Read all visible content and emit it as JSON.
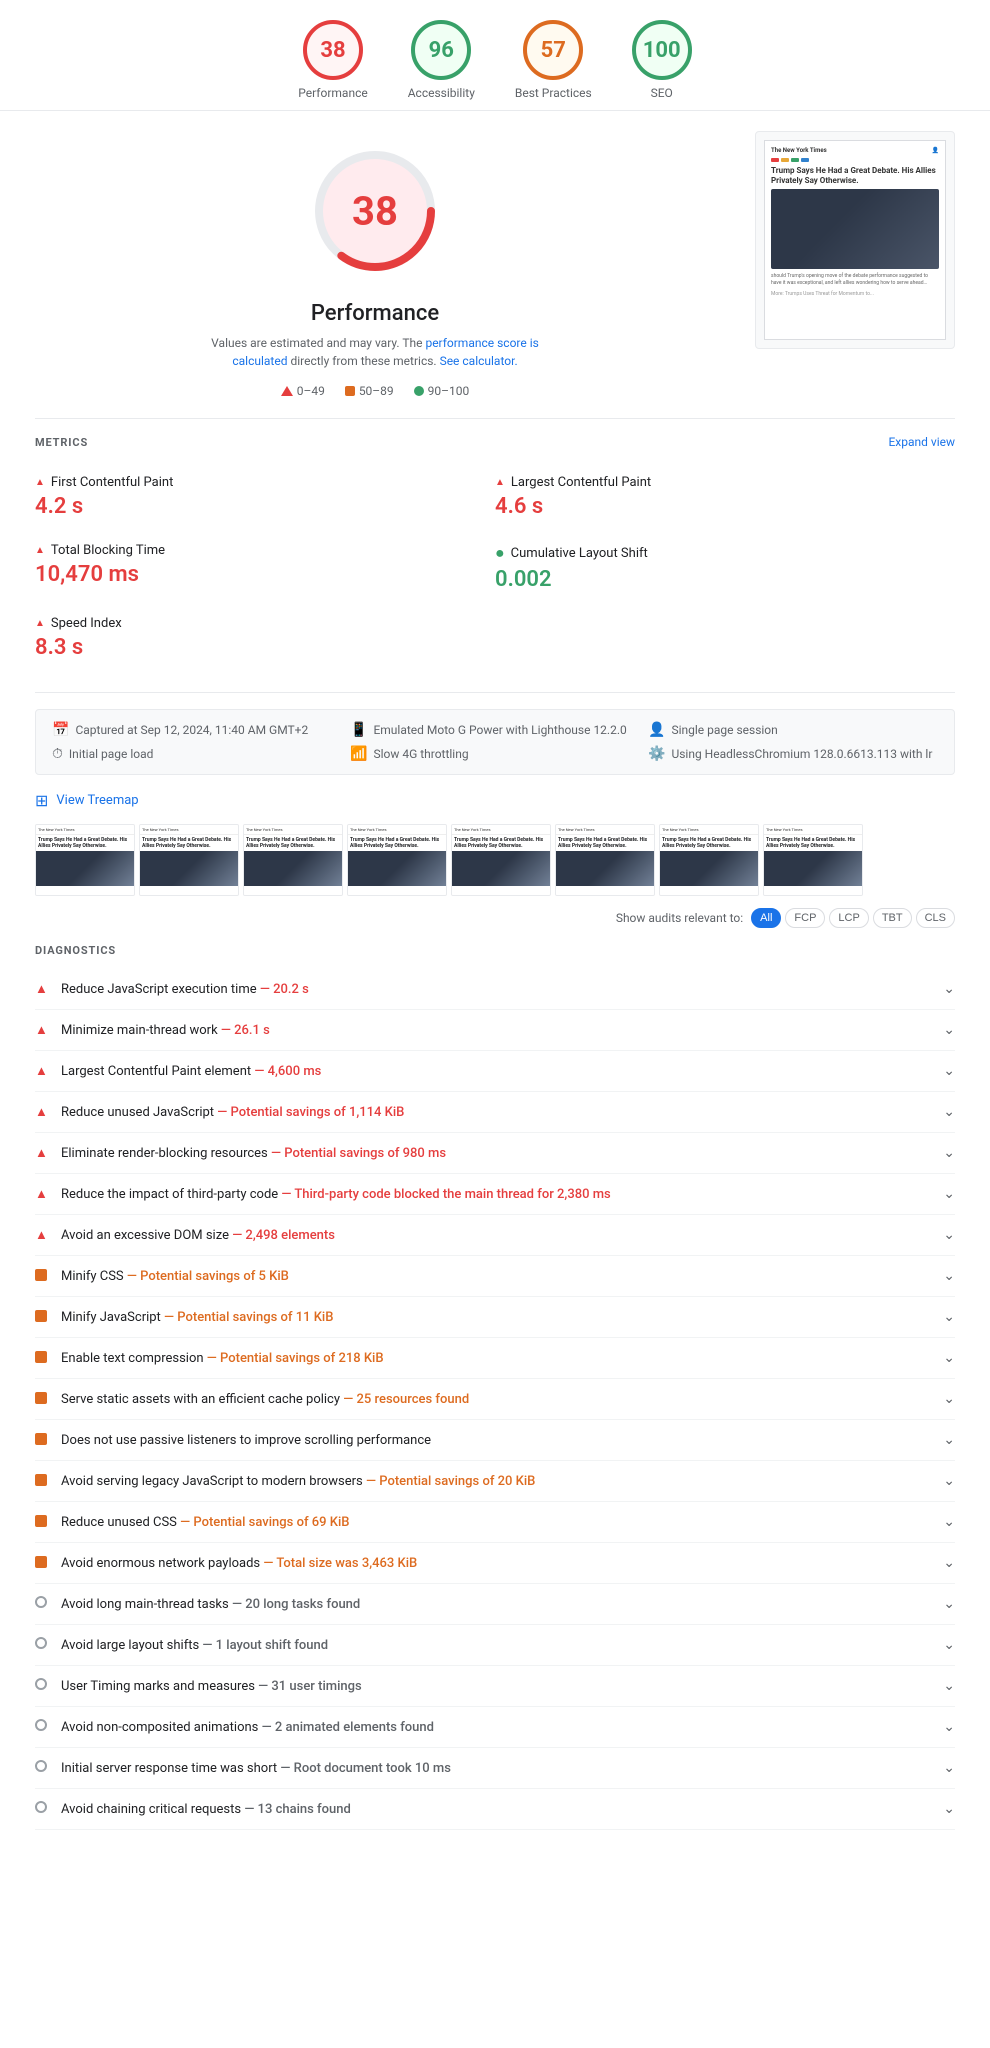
{
  "scores": [
    {
      "id": "performance",
      "value": 38,
      "label": "Performance",
      "type": "red"
    },
    {
      "id": "accessibility",
      "value": 96,
      "label": "Accessibility",
      "type": "green"
    },
    {
      "id": "best-practices",
      "value": 57,
      "label": "Best Practices",
      "type": "orange"
    },
    {
      "id": "seo",
      "value": 100,
      "label": "SEO",
      "type": "green"
    }
  ],
  "performance": {
    "score": 38,
    "title": "Performance",
    "desc_text": "Values are estimated and may vary. The ",
    "desc_link1": "performance score is calculated",
    "desc_mid": " directly from these metrics. ",
    "desc_link2": "See calculator.",
    "legend": [
      {
        "type": "tri",
        "range": "0–49"
      },
      {
        "type": "sq",
        "range": "50–89"
      },
      {
        "type": "dot",
        "range": "90–100"
      }
    ]
  },
  "metrics": {
    "title": "METRICS",
    "expand_label": "Expand view",
    "items": [
      {
        "id": "fcp",
        "name": "First Contentful Paint",
        "value": "4.2 s",
        "color": "red",
        "icon": "tri"
      },
      {
        "id": "lcp",
        "name": "Largest Contentful Paint",
        "value": "4.6 s",
        "color": "red",
        "icon": "tri"
      },
      {
        "id": "tbt",
        "name": "Total Blocking Time",
        "value": "10,470 ms",
        "color": "red",
        "icon": "tri"
      },
      {
        "id": "cls",
        "name": "Cumulative Layout Shift",
        "value": "0.002",
        "color": "green",
        "icon": "dot"
      },
      {
        "id": "si",
        "name": "Speed Index",
        "value": "8.3 s",
        "color": "red",
        "icon": "tri"
      }
    ]
  },
  "capture": {
    "date": "Captured at Sep 12, 2024, 11:40 AM GMT+2",
    "device": "Emulated Moto G Power with Lighthouse 12.2.0",
    "session": "Single page session",
    "load": "Initial page load",
    "throttle": "Slow 4G throttling",
    "browser": "Using HeadlessChromium 128.0.6613.113 with lr"
  },
  "treemap": {
    "label": "View Treemap"
  },
  "filters": {
    "label": "Show audits relevant to:",
    "buttons": [
      "All",
      "FCP",
      "LCP",
      "TBT",
      "CLS"
    ]
  },
  "diagnostics": {
    "title": "DIAGNOSTICS",
    "items": [
      {
        "id": "js-exec",
        "icon": "red-tri",
        "text": "Reduce JavaScript execution time",
        "detail": " — 20.2 s",
        "detail_color": "red"
      },
      {
        "id": "main-thread",
        "icon": "red-tri",
        "text": "Minimize main-thread work",
        "detail": " — 26.1 s",
        "detail_color": "red"
      },
      {
        "id": "lcp-elem",
        "icon": "red-tri",
        "text": "Largest Contentful Paint element",
        "detail": " — 4,600 ms",
        "detail_color": "red"
      },
      {
        "id": "unused-js",
        "icon": "red-tri",
        "text": "Reduce unused JavaScript",
        "detail": " — Potential savings of 1,114 KiB",
        "detail_color": "red"
      },
      {
        "id": "render-blocking",
        "icon": "red-tri",
        "text": "Eliminate render-blocking resources",
        "detail": " — Potential savings of 980 ms",
        "detail_color": "red"
      },
      {
        "id": "third-party",
        "icon": "red-tri",
        "text": "Reduce the impact of third-party code",
        "detail": " — Third-party code blocked the main thread for 2,380 ms",
        "detail_color": "red"
      },
      {
        "id": "dom-size",
        "icon": "red-tri",
        "text": "Avoid an excessive DOM size",
        "detail": " — 2,498 elements",
        "detail_color": "red"
      },
      {
        "id": "minify-css",
        "icon": "orange-sq",
        "text": "Minify CSS",
        "detail": " — Potential savings of 5 KiB",
        "detail_color": "orange"
      },
      {
        "id": "minify-js",
        "icon": "orange-sq",
        "text": "Minify JavaScript",
        "detail": " — Potential savings of 11 KiB",
        "detail_color": "orange"
      },
      {
        "id": "text-compression",
        "icon": "orange-sq",
        "text": "Enable text compression",
        "detail": " — Potential savings of 218 KiB",
        "detail_color": "orange"
      },
      {
        "id": "cache-policy",
        "icon": "orange-sq",
        "text": "Serve static assets with an efficient cache policy",
        "detail": " — 25 resources found",
        "detail_color": "orange"
      },
      {
        "id": "passive-listeners",
        "icon": "orange-sq",
        "text": "Does not use passive listeners to improve scrolling performance",
        "detail": "",
        "detail_color": "orange"
      },
      {
        "id": "legacy-js",
        "icon": "orange-sq",
        "text": "Avoid serving legacy JavaScript to modern browsers",
        "detail": " — Potential savings of 20 KiB",
        "detail_color": "orange"
      },
      {
        "id": "unused-css",
        "icon": "orange-sq",
        "text": "Reduce unused CSS",
        "detail": " — Potential savings of 69 KiB",
        "detail_color": "orange"
      },
      {
        "id": "network-payloads",
        "icon": "orange-sq",
        "text": "Avoid enormous network payloads",
        "detail": " — Total size was 3,463 KiB",
        "detail_color": "orange"
      },
      {
        "id": "long-tasks",
        "icon": "gray-circle",
        "text": "Avoid long main-thread tasks",
        "detail": " — 20 long tasks found",
        "detail_color": "gray"
      },
      {
        "id": "layout-shifts",
        "icon": "gray-circle",
        "text": "Avoid large layout shifts",
        "detail": " — 1 layout shift found",
        "detail_color": "gray"
      },
      {
        "id": "user-timing",
        "icon": "gray-circle",
        "text": "User Timing marks and measures",
        "detail": " — 31 user timings",
        "detail_color": "gray"
      },
      {
        "id": "non-composited",
        "icon": "gray-circle",
        "text": "Avoid non-composited animations",
        "detail": " — 2 animated elements found",
        "detail_color": "gray"
      },
      {
        "id": "server-response",
        "icon": "gray-circle",
        "text": "Initial server response time was short",
        "detail": " — Root document took 10 ms",
        "detail_color": "gray"
      },
      {
        "id": "critical-requests",
        "icon": "gray-circle",
        "text": "Avoid chaining critical requests",
        "detail": " — 13 chains found",
        "detail_color": "gray"
      }
    ]
  }
}
